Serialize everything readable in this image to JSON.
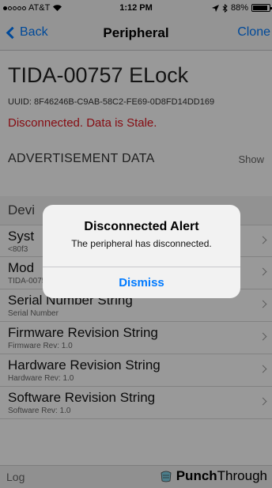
{
  "status_bar": {
    "carrier": "AT&T",
    "time": "1:12 PM",
    "battery_percent": "88%",
    "battery_level": 0.88,
    "location_icon": "location-arrow-icon",
    "bluetooth_icon": "bluetooth-icon",
    "wifi_icon": "wifi-icon"
  },
  "nav": {
    "back_label": "Back",
    "title": "Peripheral",
    "clone_label": "Clone"
  },
  "device": {
    "name": "TIDA-00757 ELock",
    "uuid": "UUID: 8F46246B-C9AB-58C2-FE69-0D8FD14DD169",
    "status": "Disconnected. Data is Stale."
  },
  "advertisement": {
    "title": "ADVERTISEMENT DATA",
    "toggle_label": "Show"
  },
  "device_info": {
    "section_title": "Devi",
    "items": [
      {
        "title": "Syst",
        "subtitle": "<80f3"
      },
      {
        "title": "Mod",
        "subtitle": "TIDA-0075"
      },
      {
        "title": "Serial Number String",
        "subtitle": "Serial Number"
      },
      {
        "title": "Firmware Revision String",
        "subtitle": "Firmware Rev: 1.0"
      },
      {
        "title": "Hardware Revision String",
        "subtitle": "Hardware Rev: 1.0"
      },
      {
        "title": "Software Revision String",
        "subtitle": "Software Rev: 1.0"
      }
    ]
  },
  "bottom_bar": {
    "log_label": "Log",
    "brand_bold": "Punch",
    "brand_light": "Through"
  },
  "alert": {
    "title": "Disconnected Alert",
    "message": "The peripheral has disconnected.",
    "button_label": "Dismiss"
  },
  "colors": {
    "accent": "#007aff",
    "error": "#e0141e"
  }
}
